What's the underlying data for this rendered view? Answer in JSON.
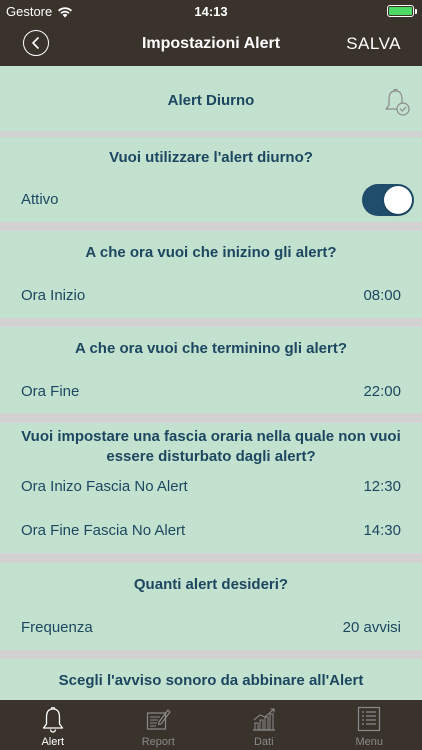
{
  "status": {
    "carrier": "Gestore",
    "time": "14:13"
  },
  "nav": {
    "title": "Impostazioni Alert",
    "save": "SALVA"
  },
  "sections": {
    "header_title": "Alert Diurno",
    "day_alert": {
      "question": "Vuoi utilizzare l'alert diurno?",
      "label": "Attivo",
      "enabled": true
    },
    "start": {
      "question": "A che ora vuoi che inizino gli alert?",
      "label": "Ora Inizio",
      "value": "08:00"
    },
    "end": {
      "question": "A che ora vuoi che terminino gli alert?",
      "label": "Ora Fine",
      "value": "22:00"
    },
    "no_alert": {
      "question": "Vuoi impostare una fascia oraria nella quale non vuoi essere disturbato dagli alert?",
      "start_label": "Ora Inizo Fascia No Alert",
      "start_value": "12:30",
      "end_label": "Ora Fine Fascia No Alert",
      "end_value": "14:30"
    },
    "frequency": {
      "question": "Quanti alert desideri?",
      "label": "Frequenza",
      "value": "20 avvisi"
    },
    "sound": {
      "question": "Scegli l'avviso sonoro da abbinare all'Alert"
    }
  },
  "tabs": [
    {
      "label": "Alert",
      "icon": "bell-icon",
      "active": true
    },
    {
      "label": "Report",
      "icon": "report-icon",
      "active": false
    },
    {
      "label": "Dati",
      "icon": "chart-icon",
      "active": false
    },
    {
      "label": "Menu",
      "icon": "menu-icon",
      "active": false
    }
  ],
  "colors": {
    "bar": "#3a332c",
    "card": "#c2e2cf",
    "text": "#1d4760",
    "toggle": "#1f4d6b",
    "separator": "#d2d2d2"
  }
}
